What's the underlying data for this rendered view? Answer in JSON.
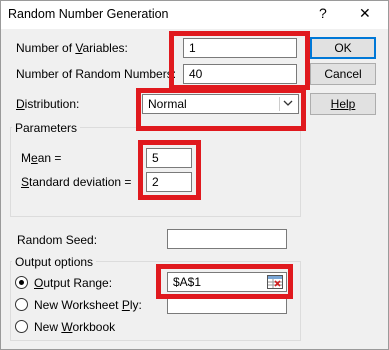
{
  "window": {
    "title": "Random Number Generation",
    "help_glyph": "?",
    "close_glyph": "✕"
  },
  "buttons": {
    "ok": "OK",
    "cancel": "Cancel",
    "help": "Help"
  },
  "fields": {
    "num_variables": {
      "label_pre": "Number of ",
      "label_u": "V",
      "label_post": "ariables:",
      "value": "1"
    },
    "num_random": {
      "label": "Number of Random Numbers:",
      "value": "40"
    },
    "distribution": {
      "label_pre": "",
      "label_u": "D",
      "label_post": "istribution:",
      "value": "Normal"
    }
  },
  "parameters": {
    "title": "Parameters",
    "mean": {
      "label_pre": "M",
      "label_u": "e",
      "label_post": "an =",
      "value": "5"
    },
    "std_dev": {
      "label_pre": "",
      "label_u": "S",
      "label_post": "tandard deviation =",
      "value": "2"
    }
  },
  "random_seed": {
    "label": "Random Seed:",
    "value": ""
  },
  "output": {
    "title": "Output options",
    "output_range": {
      "label_pre": "",
      "label_u": "O",
      "label_post": "utput Range:",
      "value": "$A$1",
      "selected": true
    },
    "new_sheet": {
      "label_pre": "New Worksheet ",
      "label_u": "P",
      "label_post": "ly:",
      "selected": false
    },
    "new_workbook": {
      "label_pre": "New ",
      "label_u": "W",
      "label_post": "orkbook",
      "selected": false
    }
  },
  "colors": {
    "highlight": "#e0191e",
    "default_button": "#0078d7"
  },
  "icons": {
    "dropdown": "chevron-down-icon",
    "range_picker": "range-selector-icon"
  }
}
